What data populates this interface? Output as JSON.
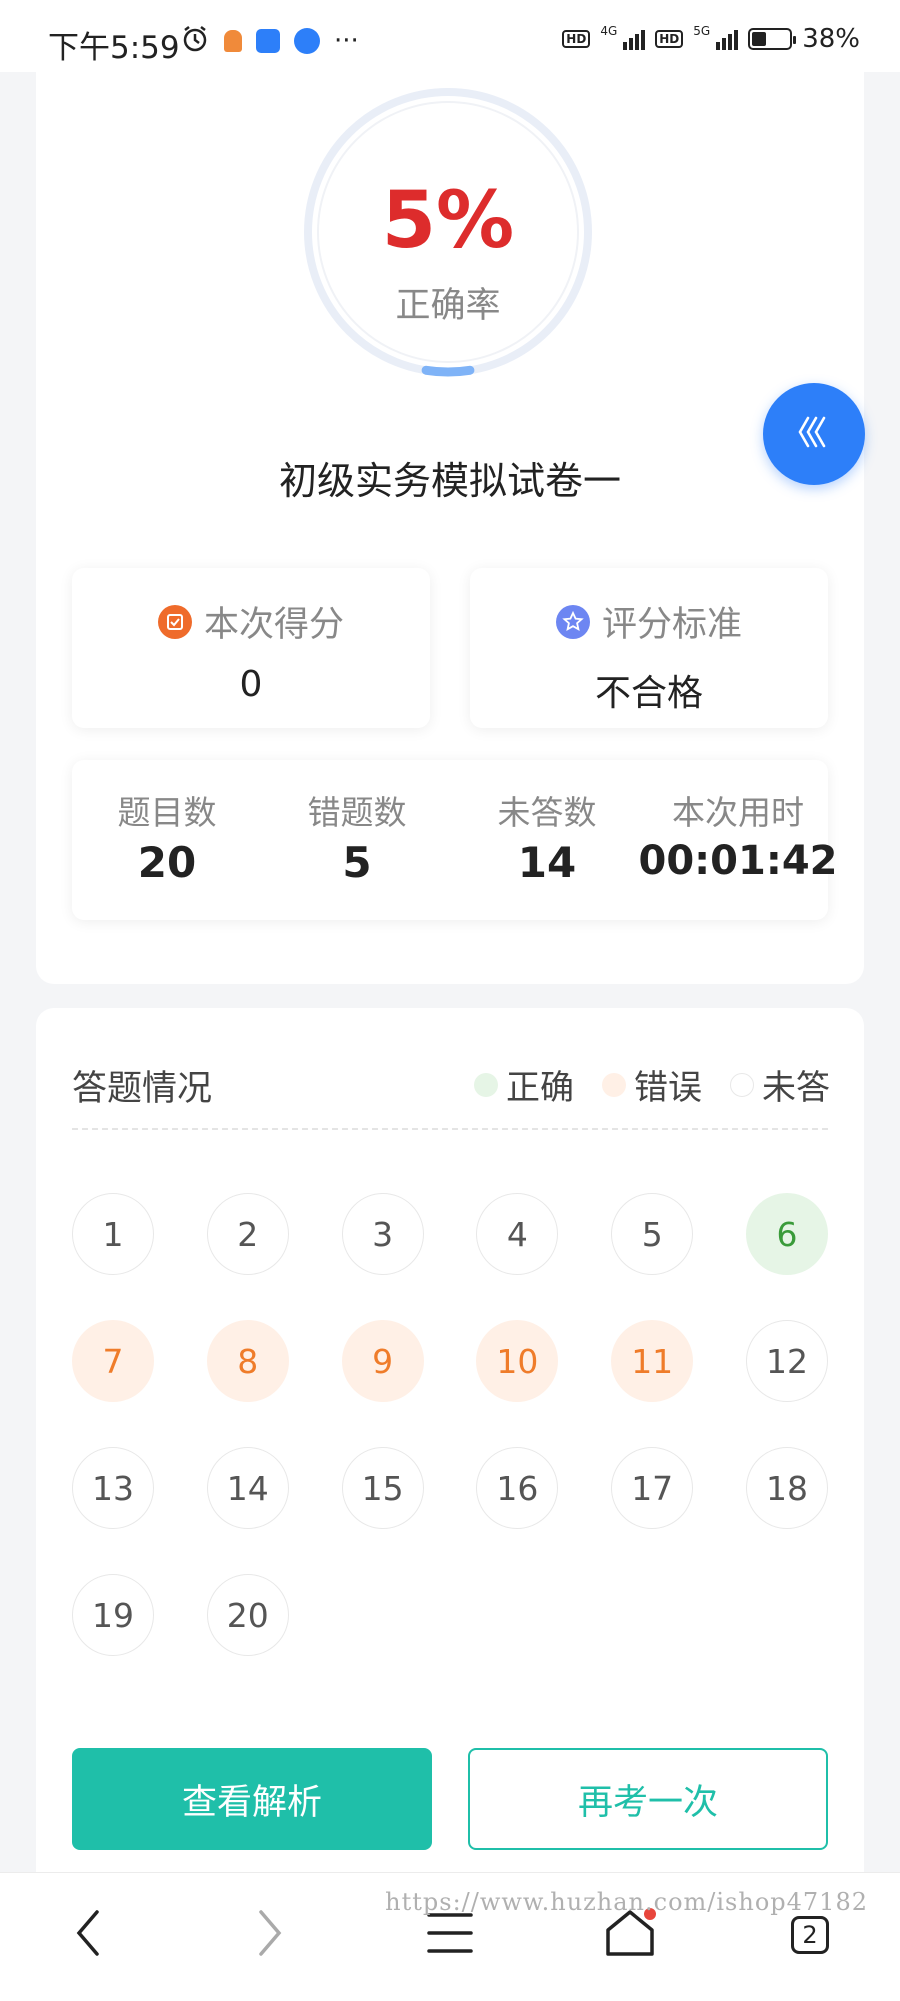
{
  "status_bar": {
    "time": "下午5:59",
    "hd1": "HD",
    "net1": "4G",
    "hd2": "HD",
    "net2": "5G",
    "battery": "38%",
    "battery_level": 0.38,
    "more": "···"
  },
  "result": {
    "accuracy_value": "5%",
    "accuracy_fraction": 0.05,
    "accuracy_label": "正确率",
    "exam_title": "初级实务模拟试卷一",
    "score_label": "本次得分",
    "score_value": "0",
    "standard_label": "评分标准",
    "standard_value": "不合格"
  },
  "counts": [
    {
      "label": "题目数",
      "value": "20"
    },
    {
      "label": "错题数",
      "value": "5"
    },
    {
      "label": "未答数",
      "value": "14"
    },
    {
      "label": "本次用时",
      "value": "00:01:42"
    }
  ],
  "answer_sheet": {
    "title": "答题情况",
    "legend": {
      "correct": "正确",
      "wrong": "错误",
      "unanswered": "未答"
    },
    "questions": [
      {
        "n": "1",
        "status": "unanswered"
      },
      {
        "n": "2",
        "status": "unanswered"
      },
      {
        "n": "3",
        "status": "unanswered"
      },
      {
        "n": "4",
        "status": "unanswered"
      },
      {
        "n": "5",
        "status": "unanswered"
      },
      {
        "n": "6",
        "status": "correct"
      },
      {
        "n": "7",
        "status": "wrong"
      },
      {
        "n": "8",
        "status": "wrong"
      },
      {
        "n": "9",
        "status": "wrong"
      },
      {
        "n": "10",
        "status": "wrong"
      },
      {
        "n": "11",
        "status": "wrong"
      },
      {
        "n": "12",
        "status": "unanswered"
      },
      {
        "n": "13",
        "status": "unanswered"
      },
      {
        "n": "14",
        "status": "unanswered"
      },
      {
        "n": "15",
        "status": "unanswered"
      },
      {
        "n": "16",
        "status": "unanswered"
      },
      {
        "n": "17",
        "status": "unanswered"
      },
      {
        "n": "18",
        "status": "unanswered"
      },
      {
        "n": "19",
        "status": "unanswered"
      },
      {
        "n": "20",
        "status": "unanswered"
      }
    ]
  },
  "actions": {
    "view_analysis": "查看解析",
    "retry": "再考一次"
  },
  "bottom_nav": {
    "tab_count": "2",
    "watermark": "https://www.huzhan.com/ishop47182"
  },
  "colors": {
    "accent": "#1fbfa9",
    "danger": "#dd2c2c",
    "correct_bg": "#e6f5e6",
    "wrong_bg": "#fff0e6",
    "fab": "#2d7ff9"
  },
  "icons": [
    "alarm-icon",
    "app-notification-icon",
    "back-icon",
    "forward-icon",
    "menu-icon",
    "home-icon",
    "tabs-icon",
    "collapse-chevrons-icon",
    "score-icon",
    "star-badge-icon"
  ]
}
